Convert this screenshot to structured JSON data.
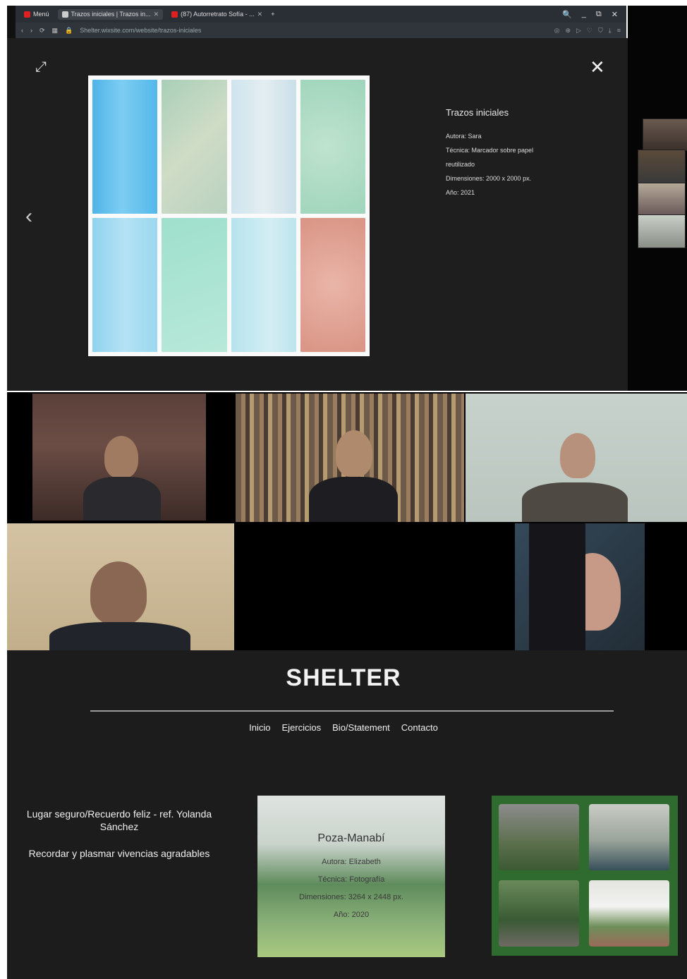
{
  "browser": {
    "tabs": [
      {
        "label": "Menú",
        "color": "#e02020"
      },
      {
        "label": "Trazos iniciales | Trazos in...",
        "color": "#cccccc"
      },
      {
        "label": "(87) Autorretrato Sofía - ...",
        "color": "#e02020"
      }
    ],
    "tab_close": "✕",
    "new_tab": "+",
    "window_controls": [
      "🔍",
      "_",
      "⧉",
      "✕"
    ],
    "nav_icons": [
      "‹",
      "›",
      "⟳",
      "▦"
    ],
    "url": "Shelter.wixsite.com/website/trazos-iniciales",
    "address_icons": [
      "◎",
      "⊕",
      "▷",
      "♡",
      "⛉",
      "⤓",
      "≡"
    ]
  },
  "lightbox": {
    "expand_icon": "⤢",
    "close_icon": "✕",
    "prev_icon": "‹",
    "title": "Trazos iniciales",
    "lines": [
      "Autora: Sara",
      "Técnica: Marcador sobre papel",
      "reutilizado",
      "Dimensiones: 2000 x 2000 px.",
      "Año: 2021"
    ]
  },
  "site": {
    "logo": "SHELTER",
    "nav": [
      "Inicio",
      "Ejercicios",
      "Bio/Statement",
      "Contacto"
    ],
    "project_title": "Lugar seguro/Recuerdo feliz - ref. Yolanda Sánchez",
    "project_subtitle": "Recordar y plasmar vivencias agradables",
    "poster": {
      "title": "Poza-Manabí",
      "lines": [
        "Autora: Elizabeth",
        "Técnica: Fotografía",
        "Dimensiones: 3264 x 2448 px.",
        "Año: 2020"
      ]
    }
  }
}
